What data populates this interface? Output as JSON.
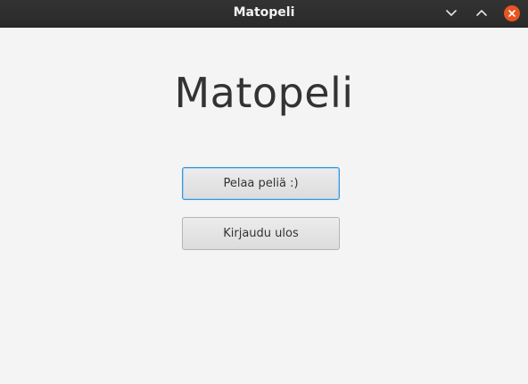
{
  "window": {
    "title": "Matopeli",
    "controls": {
      "minimize": "minimize-icon",
      "maximize": "maximize-icon",
      "close": "close-icon"
    },
    "accent_close": "#e95420"
  },
  "main": {
    "heading": "Matopeli",
    "buttons": {
      "play_label": "Pelaa peliä :)",
      "logout_label": "Kirjaudu ulos"
    },
    "focus_color": "#3a97d9",
    "background": "#f4f4f4"
  }
}
